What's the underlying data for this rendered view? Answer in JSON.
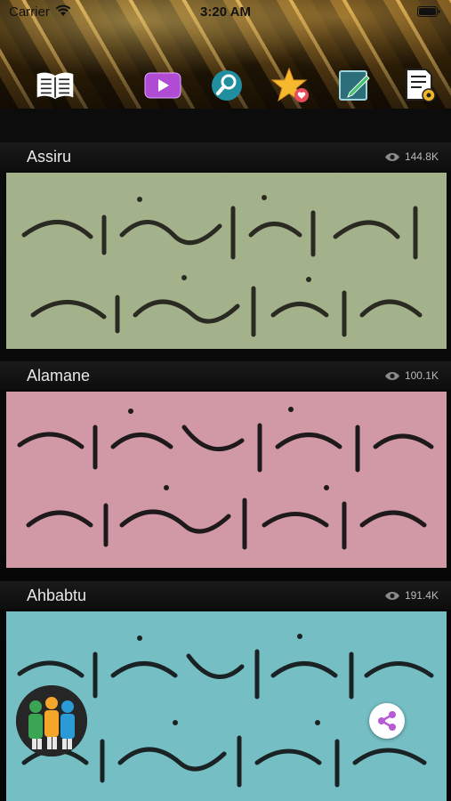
{
  "status_bar": {
    "carrier": "Carrier",
    "time": "3:20 AM"
  },
  "toolbar": {
    "items": [
      {
        "icon": "book-icon"
      },
      {
        "icon": "video-icon"
      },
      {
        "icon": "search-icon"
      },
      {
        "icon": "favorites-star-icon"
      },
      {
        "icon": "edit-icon"
      },
      {
        "icon": "settings-document-icon"
      }
    ]
  },
  "sections": [
    {
      "title": "Assiru",
      "views": "144.8K",
      "background": "#a7b48e"
    },
    {
      "title": "Alamane",
      "views": "100.1K",
      "background": "#d29aa8"
    },
    {
      "title": "Ahbabtu",
      "views": "191.4K",
      "background": "#76bfc5"
    }
  ],
  "colors": {
    "accent_gold": "#c9a24f",
    "views_text": "#b9b9b9",
    "share_accent": "#b85ad6"
  },
  "floating": {
    "community_icon": "community-people-icon",
    "share_icon": "share-icon"
  }
}
